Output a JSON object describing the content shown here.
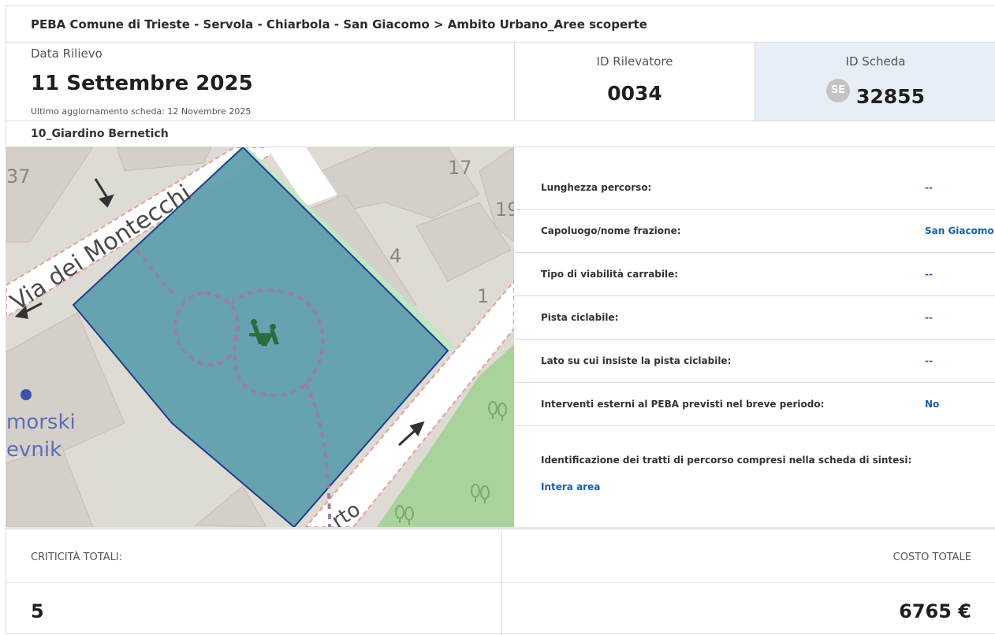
{
  "breadcrumb": "PEBA Comune di Trieste - Servola - Chiarbola - San Giacomo > Ambito Urbano_Aree scoperte",
  "survey": {
    "date_label": "Data Rilievo",
    "date_value": "11 Settembre 2025",
    "updated": "Ultimo aggiornamento scheda: 12 Novembre 2025",
    "surveyor_label": "ID Rilevatore",
    "surveyor_value": "0034",
    "sheet_label": "ID Scheda",
    "sheet_badge": "SE",
    "sheet_value": "32855"
  },
  "place_name": "10_Giardino Bernetich",
  "map": {
    "street_name": "Via dei Montecchi",
    "house_numbers": [
      "37",
      "17",
      "19",
      "4",
      "1"
    ],
    "poi_label_line1": "morski",
    "poi_label_line2": "evnik",
    "street_fragment": "rto",
    "icons": [
      "playground-icon",
      "park-tree-icon",
      "oneway-arrow-icon"
    ],
    "colors": {
      "polygon_fill": "#5f9fae",
      "polygon_stroke": "#1e3f8a",
      "park": "#a9d39a",
      "road": "#ffffff",
      "building": "#d5cfc9",
      "ground": "#dedad4"
    }
  },
  "properties": [
    {
      "label": "Lunghezza percorso:",
      "value": "--"
    },
    {
      "label": "Capoluogo/nome frazione:",
      "value": "San Giacomo"
    },
    {
      "label": "Tipo di viabilità carrabile:",
      "value": "--"
    },
    {
      "label": "Pista ciclabile:",
      "value": "--"
    },
    {
      "label": "Lato su cui insiste la pista ciclabile:",
      "value": "--"
    },
    {
      "label": "Interventi esterni al PEBA previsti nel breve periodo:",
      "value": "No"
    }
  ],
  "route_segments": {
    "label": "Identificazione dei tratti di percorso compresi nella scheda di sintesi:",
    "value": "Intera area"
  },
  "totals": {
    "criticality_label": "CRITICITÀ TOTALI:",
    "criticality_value": "5",
    "cost_label": "COSTO TOTALE",
    "cost_value": "6765 €"
  }
}
